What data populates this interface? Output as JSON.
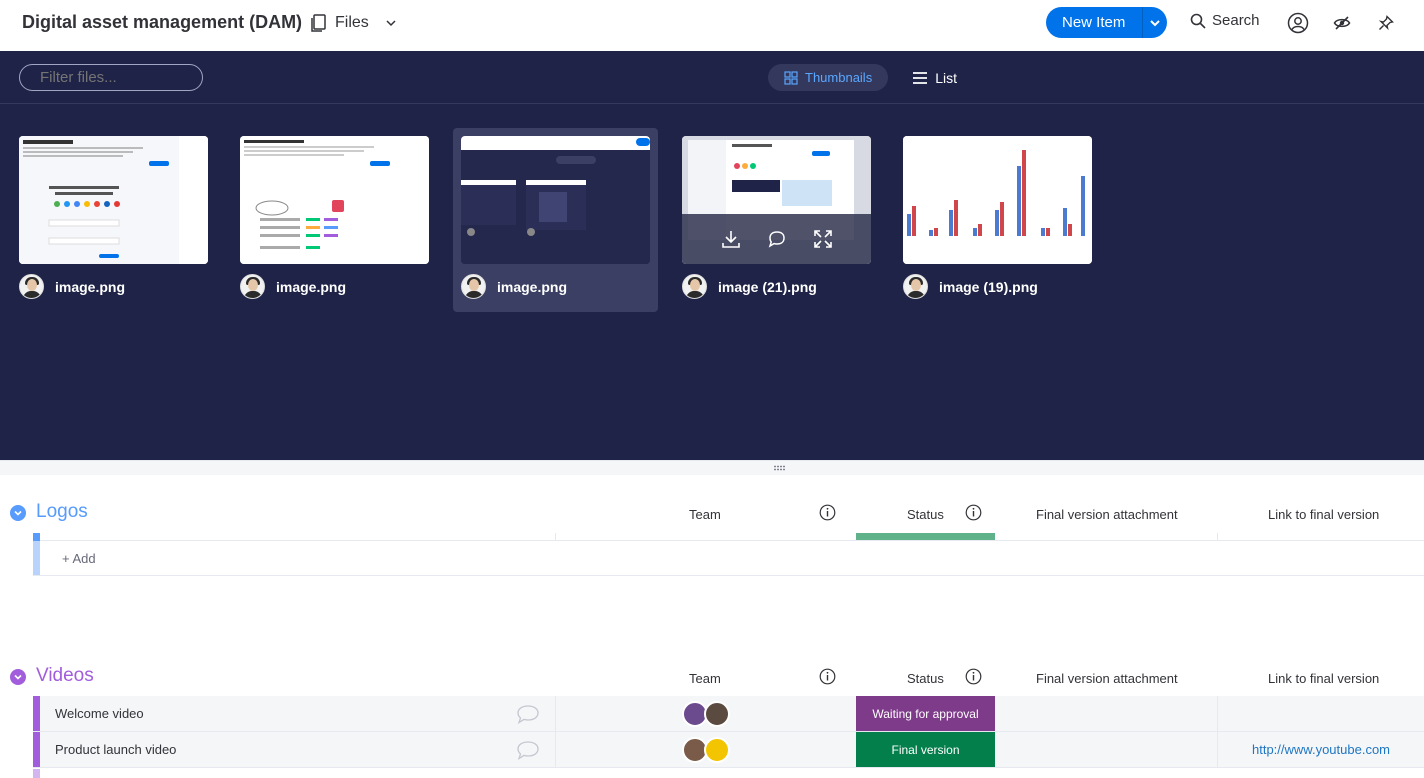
{
  "header": {
    "board_title": "Digital asset management (DAM)",
    "view_label": "Files",
    "new_item_label": "New Item",
    "search_label": "Search"
  },
  "gallery": {
    "filter_placeholder": "Filter files...",
    "view_thumbnails": "Thumbnails",
    "view_list": "List",
    "files": [
      {
        "name": "image.png"
      },
      {
        "name": "image.png"
      },
      {
        "name": "image.png"
      },
      {
        "name": "image (21).png"
      },
      {
        "name": "image (19).png"
      }
    ]
  },
  "groups": [
    {
      "name": "Logos",
      "color": "#579bfc",
      "columns": {
        "team": "Team",
        "status": "Status",
        "attachment": "Final version attachment",
        "link": "Link to final version"
      },
      "add_label": "+ Add"
    },
    {
      "name": "Videos",
      "color": "#a25ddc",
      "columns": {
        "team": "Team",
        "status": "Status",
        "attachment": "Final version attachment",
        "link": "Link to final version"
      },
      "rows": [
        {
          "name": "Welcome video",
          "status": "Waiting for approval",
          "status_color": "#7e3b8a",
          "link": ""
        },
        {
          "name": "Product launch video",
          "status": "Final version",
          "status_color": "#037f4c",
          "link": "http://www.youtube.com"
        }
      ]
    }
  ],
  "colors": {
    "primary": "#0073ea",
    "gallery_bg": "#1f2347",
    "logos_status": "#5fb28a"
  }
}
